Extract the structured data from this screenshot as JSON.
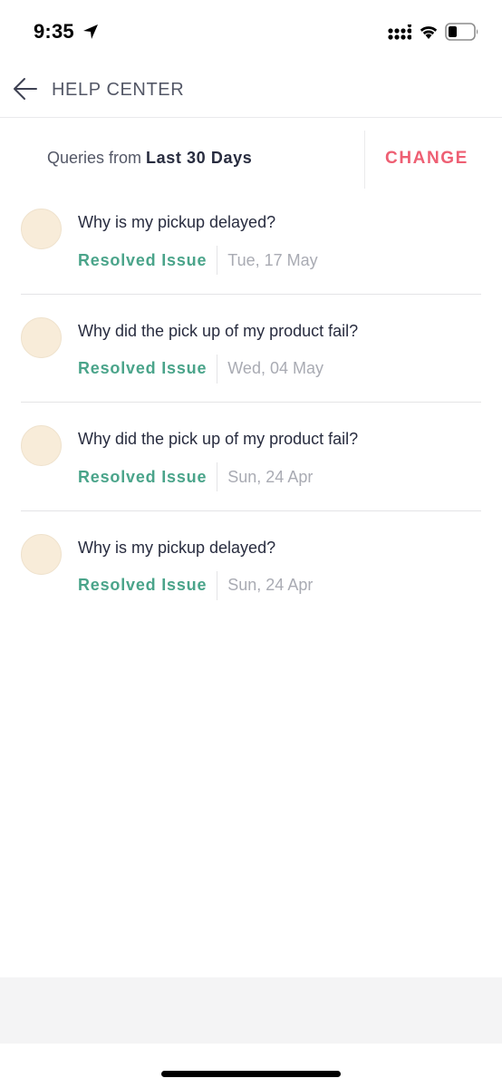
{
  "status_bar": {
    "time": "9:35",
    "icons": [
      "location-arrow-icon",
      "cellular-signal-icon",
      "wifi-icon",
      "battery-icon"
    ]
  },
  "header": {
    "back_icon": "arrow-left-icon",
    "title": "HELP CENTER"
  },
  "filter": {
    "label": "Queries from",
    "value": "Last 30 Days",
    "change_label": "CHANGE"
  },
  "queries": [
    {
      "title": "Why is my pickup delayed?",
      "status": "Resolved Issue",
      "date": "Tue, 17 May"
    },
    {
      "title": "Why did the pick up of my product fail?",
      "status": "Resolved Issue",
      "date": "Wed, 04 May"
    },
    {
      "title": "Why did the pick up of my product fail?",
      "status": "Resolved Issue",
      "date": "Sun, 24 Apr"
    },
    {
      "title": "Why is my pickup delayed?",
      "status": "Resolved Issue",
      "date": "Sun, 24 Apr"
    }
  ],
  "colors": {
    "accent": "#ee5f73",
    "resolved": "#4aa48a",
    "avatar_bg": "#f8ecd9",
    "text_primary": "#282c3f",
    "text_secondary": "#535766",
    "text_muted": "#a9abb3"
  }
}
